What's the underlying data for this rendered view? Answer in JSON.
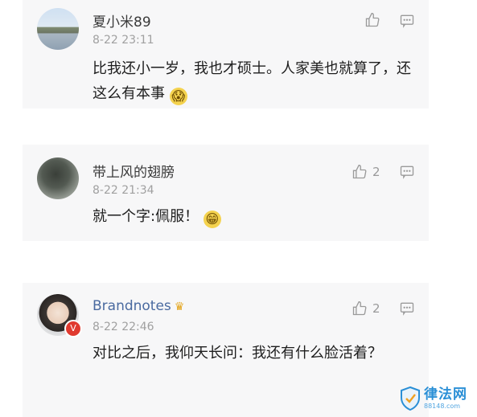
{
  "comments": [
    {
      "name": "夏小米89",
      "time": "8-22 23:11",
      "text": "比我还小一岁，我也才硕士。人家美也就算了，还这么有本事",
      "emoji": "😱",
      "likes": ""
    },
    {
      "name": "带上风的翅膀",
      "time": "8-22 21:34",
      "text": "就一个字:佩服！",
      "emoji": "😁",
      "likes": "2"
    },
    {
      "name": "Brandnotes",
      "time": "8-22 22:46",
      "text": "对比之后，我仰天长问：我还有什么脸活着？",
      "emoji": "",
      "likes": "2",
      "badge_icon": "crown-icon",
      "verified_icon": "v-badge-icon"
    }
  ],
  "watermark": {
    "title": "律法网",
    "url": "88148.com"
  },
  "colors": {
    "name": "#3a3a3a",
    "brand_name": "#4a6aa0",
    "time": "#a0a0a0",
    "watermark": "#2a8fd6"
  }
}
